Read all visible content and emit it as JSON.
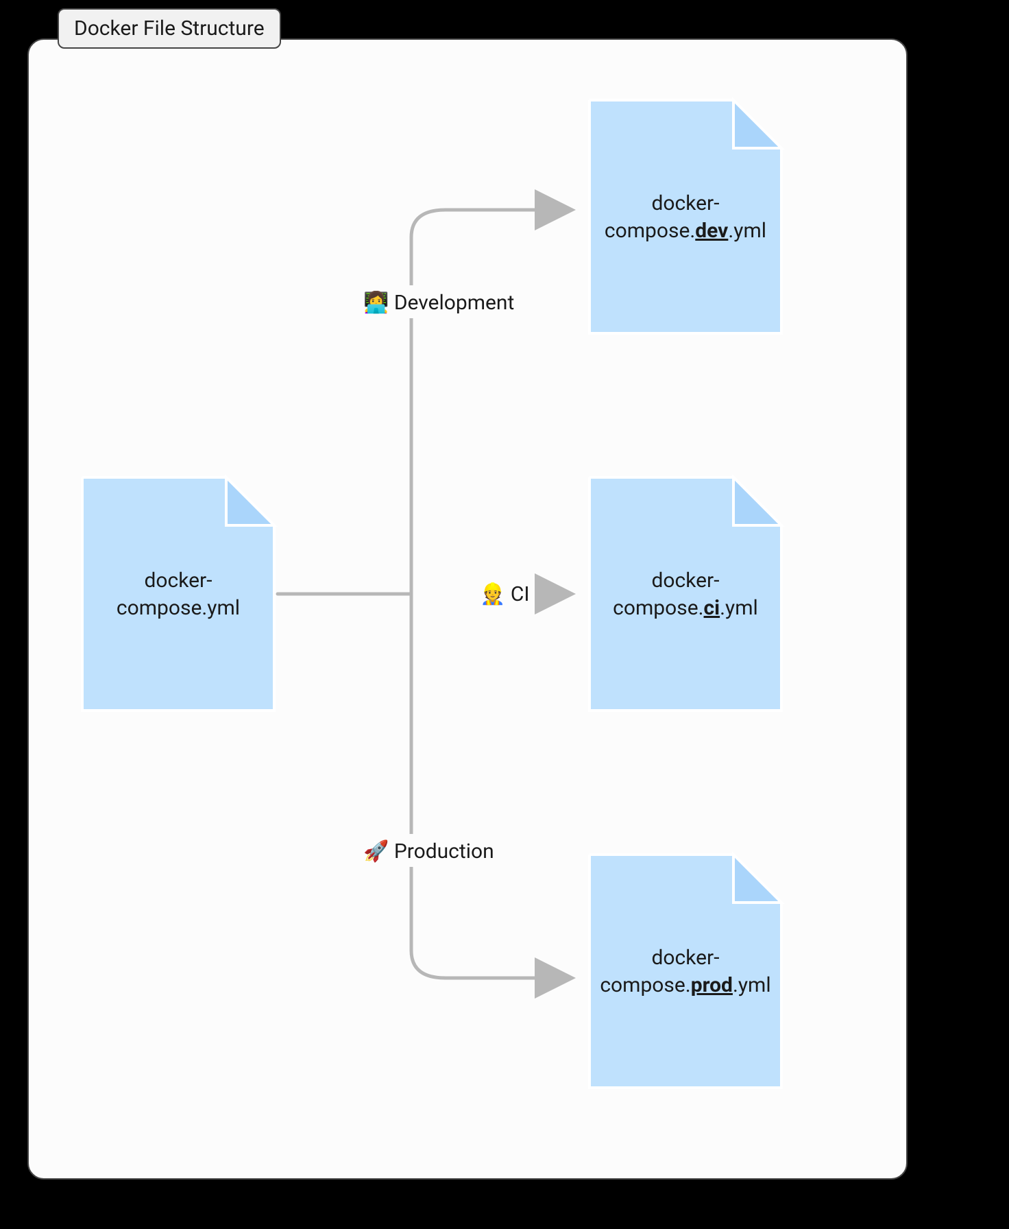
{
  "title": "Docker File Structure",
  "base_file": {
    "line1": "docker-",
    "line2": "compose.yml"
  },
  "branches": [
    {
      "emoji": "👩‍💻",
      "label": "Development",
      "file_pre": "docker-",
      "file_mid1": "compose.",
      "file_bold": "dev",
      "file_post": ".yml"
    },
    {
      "emoji": "👷",
      "label": "CI",
      "file_pre": "docker-",
      "file_mid1": "compose.",
      "file_bold": "ci",
      "file_post": ".yml"
    },
    {
      "emoji": "🚀",
      "label": "Production",
      "file_pre": "docker-",
      "file_mid1": "compose.",
      "file_bold": "prod",
      "file_post": ".yml"
    }
  ]
}
